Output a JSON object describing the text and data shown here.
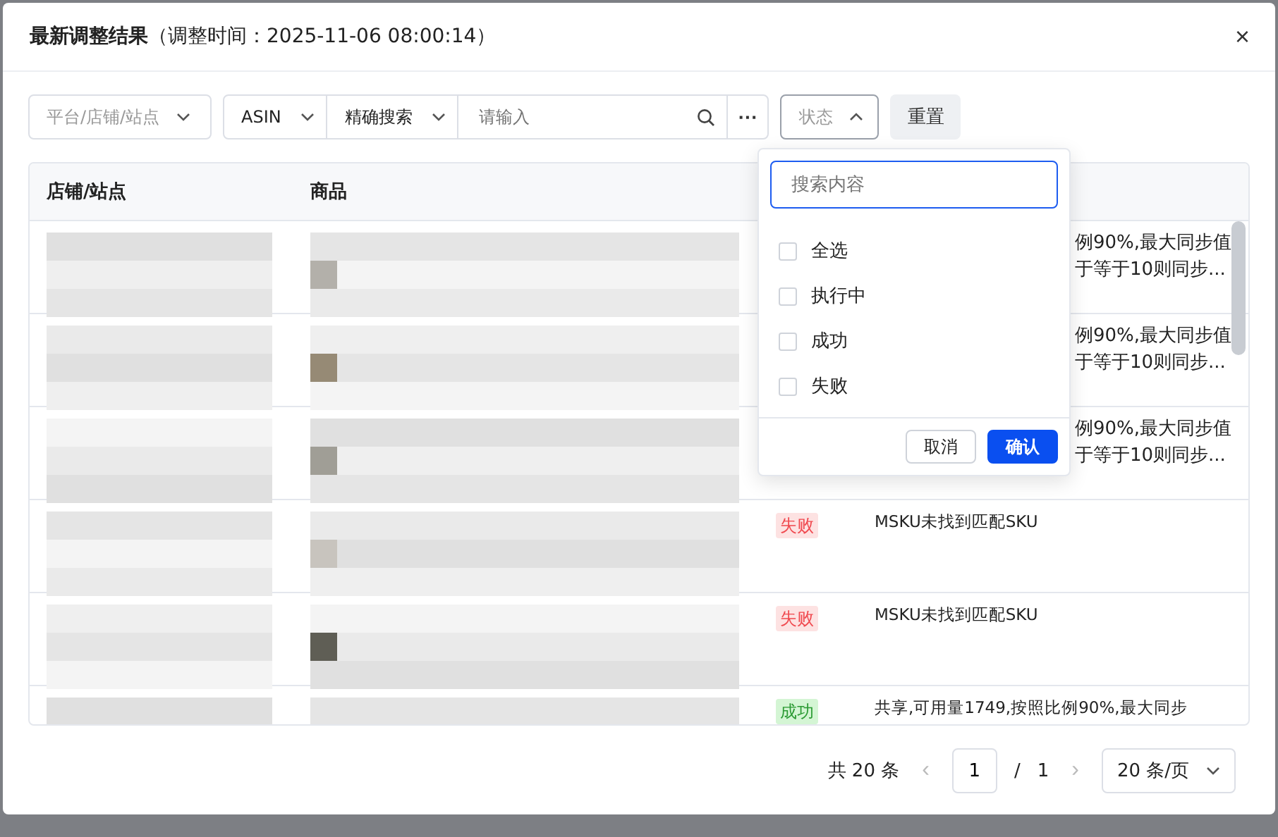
{
  "dialog": {
    "title": "最新调整结果",
    "subtitle": "（调整时间：2025-11-06 08:00:14）",
    "close": "×"
  },
  "filters": {
    "platform_placeholder": "平台/店铺/站点",
    "field": "ASIN",
    "mode": "精确搜索",
    "search_placeholder": "请输入",
    "more": "···",
    "status_placeholder": "状态",
    "status_open": true,
    "reset": "重置"
  },
  "status_menu": {
    "search_placeholder": "搜索内容",
    "options": [
      {
        "label": "全选",
        "checked": false
      },
      {
        "label": "执行中",
        "checked": false
      },
      {
        "label": "成功",
        "checked": false
      },
      {
        "label": "失败",
        "checked": false
      }
    ],
    "cancel": "取消",
    "confirm": "确认"
  },
  "table": {
    "columns": [
      "店铺/站点",
      "商品"
    ],
    "rows": [
      {
        "covered": true,
        "result_lines": [
          "例90%,最大同步值",
          "于等于10则同步..."
        ]
      },
      {
        "covered": true,
        "result_lines": [
          "例90%,最大同步值",
          "于等于10则同步..."
        ]
      },
      {
        "covered": true,
        "result_lines": [
          "例90%,最大同步值",
          "于等于10则同步..."
        ]
      },
      {
        "covered": false,
        "status": {
          "label": "失败",
          "kind": "fail"
        },
        "result_lines": [
          "MSKU未找到匹配SKU"
        ]
      },
      {
        "covered": false,
        "status": {
          "label": "失败",
          "kind": "fail"
        },
        "result_lines": [
          "MSKU未找到匹配SKU"
        ]
      },
      {
        "covered": false,
        "status": {
          "label": "成功",
          "kind": "success"
        },
        "result_lines": [
          "共享,可用量1749,按照比例90%,最大同步"
        ]
      }
    ]
  },
  "pagination": {
    "total": "共 20 条",
    "prev": "‹",
    "page": "1",
    "separator": "/",
    "pages": "1",
    "next": "›",
    "page_size": "20 条/页"
  }
}
